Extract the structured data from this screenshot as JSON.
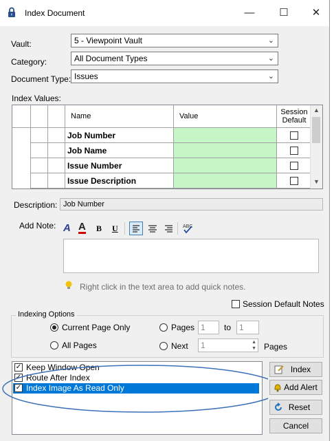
{
  "window": {
    "title": "Index Document",
    "minimize": "—",
    "maximize": "☐",
    "close": "✕"
  },
  "vault": {
    "label": "Vault:",
    "value": "5 - Viewpoint Vault"
  },
  "category": {
    "label": "Category:",
    "value": "All Document Types"
  },
  "doctype": {
    "label": "Document Type:",
    "value": "Issues"
  },
  "index_values": {
    "label": "Index Values:",
    "headers": {
      "name": "Name",
      "value": "Value",
      "session": "Session Default"
    },
    "rows": [
      {
        "name": "Job Number"
      },
      {
        "name": "Job Name"
      },
      {
        "name": "Issue Number"
      },
      {
        "name": "Issue Description"
      }
    ]
  },
  "description": {
    "label": "Description:",
    "value": "Job Number"
  },
  "add_note": {
    "label": "Add Note:",
    "toolbar": {
      "bold": "B",
      "underline": "U"
    },
    "hint": "Right click in the text area to add quick notes."
  },
  "session_default_notes": "Session Default Notes",
  "indexing_options": {
    "legend": "Indexing Options",
    "current_page_only": "Current Page Only",
    "all_pages": "All Pages",
    "pages": "Pages",
    "pages_from": "1",
    "to": "to",
    "pages_to": "1",
    "next": "Next",
    "next_value": "1",
    "pages_suffix": "Pages"
  },
  "options_list": [
    {
      "label": "Keep Window Open",
      "checked": true
    },
    {
      "label": "Route After Index",
      "checked": true
    },
    {
      "label": "Index Image As Read Only",
      "checked": true,
      "selected": true
    }
  ],
  "buttons": {
    "index": "Index",
    "add_alert": "Add Alert",
    "reset": "Reset",
    "cancel": "Cancel"
  },
  "colors": {
    "value_cell": "#c6f5c6",
    "selection": "#0078d7",
    "annotation_ellipse": "#3b6fb6"
  }
}
